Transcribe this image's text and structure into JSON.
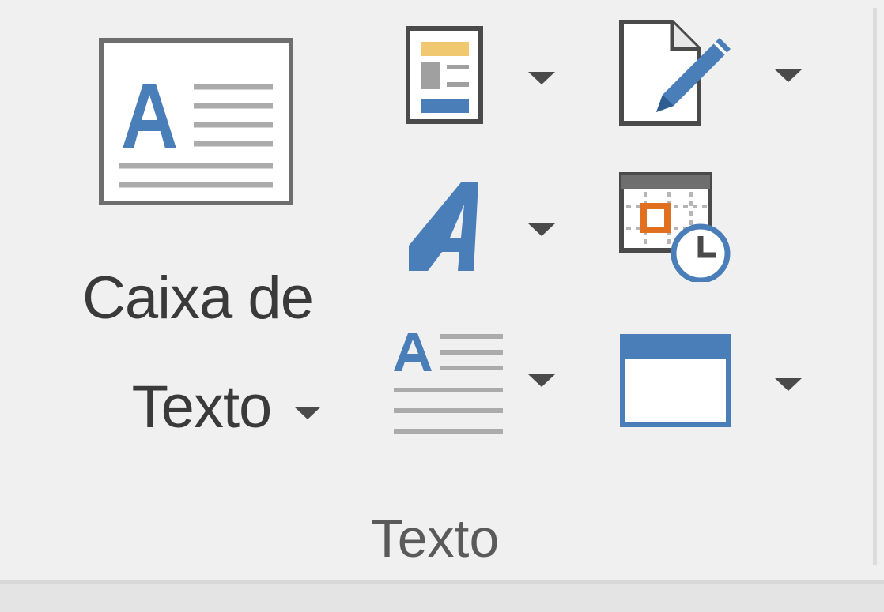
{
  "ribbon_group": {
    "text_box_button": {
      "label_line1": "Caixa de",
      "label_line2": "Texto",
      "icon": "text-box-icon"
    },
    "quick_parts_button": {
      "icon": "quick-parts-icon"
    },
    "signature_line_button": {
      "icon": "signature-line-icon"
    },
    "wordart_button": {
      "icon": "wordart-icon"
    },
    "date_time_button": {
      "icon": "date-time-icon"
    },
    "drop_cap_button": {
      "icon": "drop-cap-icon"
    },
    "object_button": {
      "icon": "object-icon"
    },
    "group_label": "Texto"
  },
  "colors": {
    "accent_blue": "#4a7eb8",
    "orange": "#e07020",
    "gold": "#f0c870",
    "gray_lines": "#ababab",
    "background": "#f0f0f0"
  }
}
